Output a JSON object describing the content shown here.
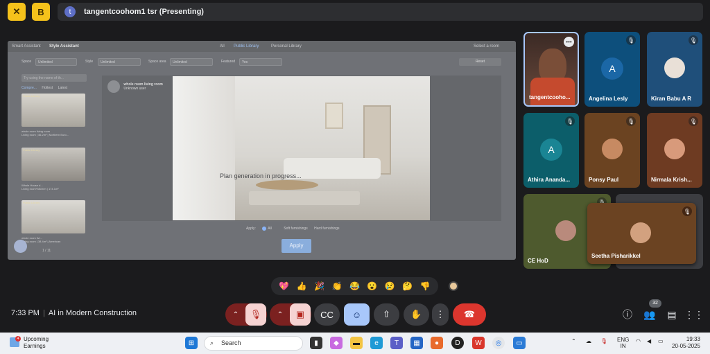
{
  "topbar": {
    "title": "tangentcoohom1 tsr (Presenting)",
    "avatar_initial": "t"
  },
  "screen": {
    "header": {
      "left1": "Smart Assistant",
      "left2": "Style Assistant",
      "tab_all": "All",
      "tab_public": "Public Library",
      "tab_personal": "Personal Library",
      "select": "Select a room"
    },
    "filters": {
      "space_label": "Space",
      "space_val": "Unlimited",
      "style_label": "Style",
      "style_val": "Unlimited",
      "area_label": "Space area",
      "area_val": "Unlimited",
      "featured_label": "Featured",
      "featured_val": "Yes",
      "reset": "Reset"
    },
    "search_placeholder": "Try using the name of th...",
    "sorts": [
      "Compre...",
      "Hottest",
      "Latest"
    ],
    "thumbs": [
      {
        "tag": "Public Library",
        "cap1": "whole room living room",
        "cap2": "Living room | 46.2m² | Northern Euro..."
      },
      {
        "tag": "Public Library",
        "cap1": "Whole House d...",
        "cap2": "Living room+kitchen | 174.1m²"
      },
      {
        "tag": "Public Library",
        "cap1": "whole room livi...",
        "cap2": "Living room | 38.4m² | American"
      }
    ],
    "pager": "1   / 11",
    "user_name": "whole room living room",
    "user_sub": "Unknown user",
    "progress": "Plan generation in progress...",
    "apply_label": "Apply:",
    "apply_all": "All",
    "apply_soft": "Soft furnishings",
    "apply_hard": "Hard furnishings",
    "apply_btn": "Apply"
  },
  "participants": [
    {
      "name": "tangentcooho...",
      "kind": "video"
    },
    {
      "name": "Angelina Lesly",
      "initial": "A"
    },
    {
      "name": "Kiran Babu A R"
    },
    {
      "name": "Athira Ananda...",
      "initial": "A"
    },
    {
      "name": "Ponsy Paul"
    },
    {
      "name": "Nirmala Krish..."
    },
    {
      "name": "CE HoD"
    },
    {
      "name": "Seetha Pisharikkel"
    }
  ],
  "reactions": [
    "💖",
    "👍",
    "🎉",
    "👏",
    "😂",
    "😮",
    "😢",
    "🤔",
    "👎"
  ],
  "meeting": {
    "time": "7:33 PM",
    "name": "AI in Modern Construction"
  },
  "people_count": "32",
  "taskbar": {
    "weather_title": "Upcoming",
    "weather_sub": "Earnings",
    "weather_badge": "4",
    "search": "Search",
    "lang1": "ENG",
    "lang2": "IN",
    "time": "19:33",
    "date": "20-05-2025"
  },
  "colors": {
    "accent": "#f5c21b",
    "danger": "#dc362e",
    "blue": "#a8c7fa"
  }
}
